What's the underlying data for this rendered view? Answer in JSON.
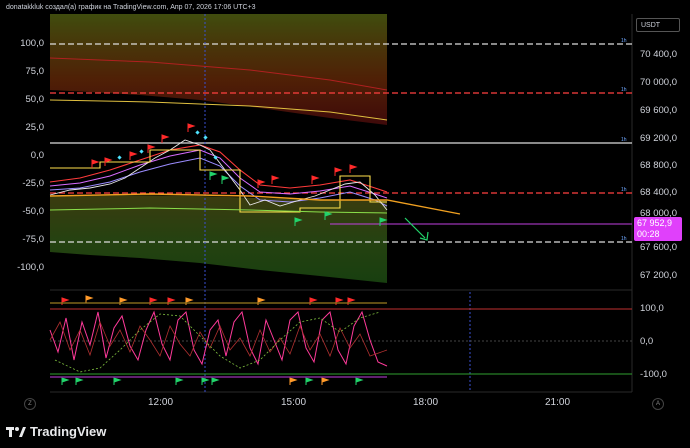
{
  "header": {
    "title": "donatakkluk создал(а) график на TradingView.com, Апр 07, 2026 17:06 UTC+3"
  },
  "currency": "USDT",
  "left_axis": [
    "100,0",
    "75,0",
    "50,0",
    "25,0",
    "0,0",
    "-25,0",
    "-50,0",
    "-75,0",
    "-100,0"
  ],
  "right_axis": [
    "70 400,0",
    "70 000,0",
    "69 600,0",
    "69 200,0",
    "68 800,0",
    "68 400,0",
    "68 000,0",
    "67 600,0",
    "67 200,0"
  ],
  "last_price": {
    "value": "67 952,9",
    "timer": "00:28"
  },
  "osc_axis": [
    "100,0",
    "0,0",
    "-100,0"
  ],
  "time_axis": [
    "12:00",
    "15:00",
    "18:00",
    "21:00"
  ],
  "tags": {
    "line_tag": "1h"
  },
  "corners": {
    "left": "Z",
    "right": "A"
  },
  "brand": {
    "name": "TradingView"
  },
  "colors": {
    "bg": "#000000",
    "price_tag": "#e040fb",
    "accent_red": "#ff3b3b",
    "accent_green": "#22d36b",
    "accent_yellow": "#ffe14d"
  }
}
